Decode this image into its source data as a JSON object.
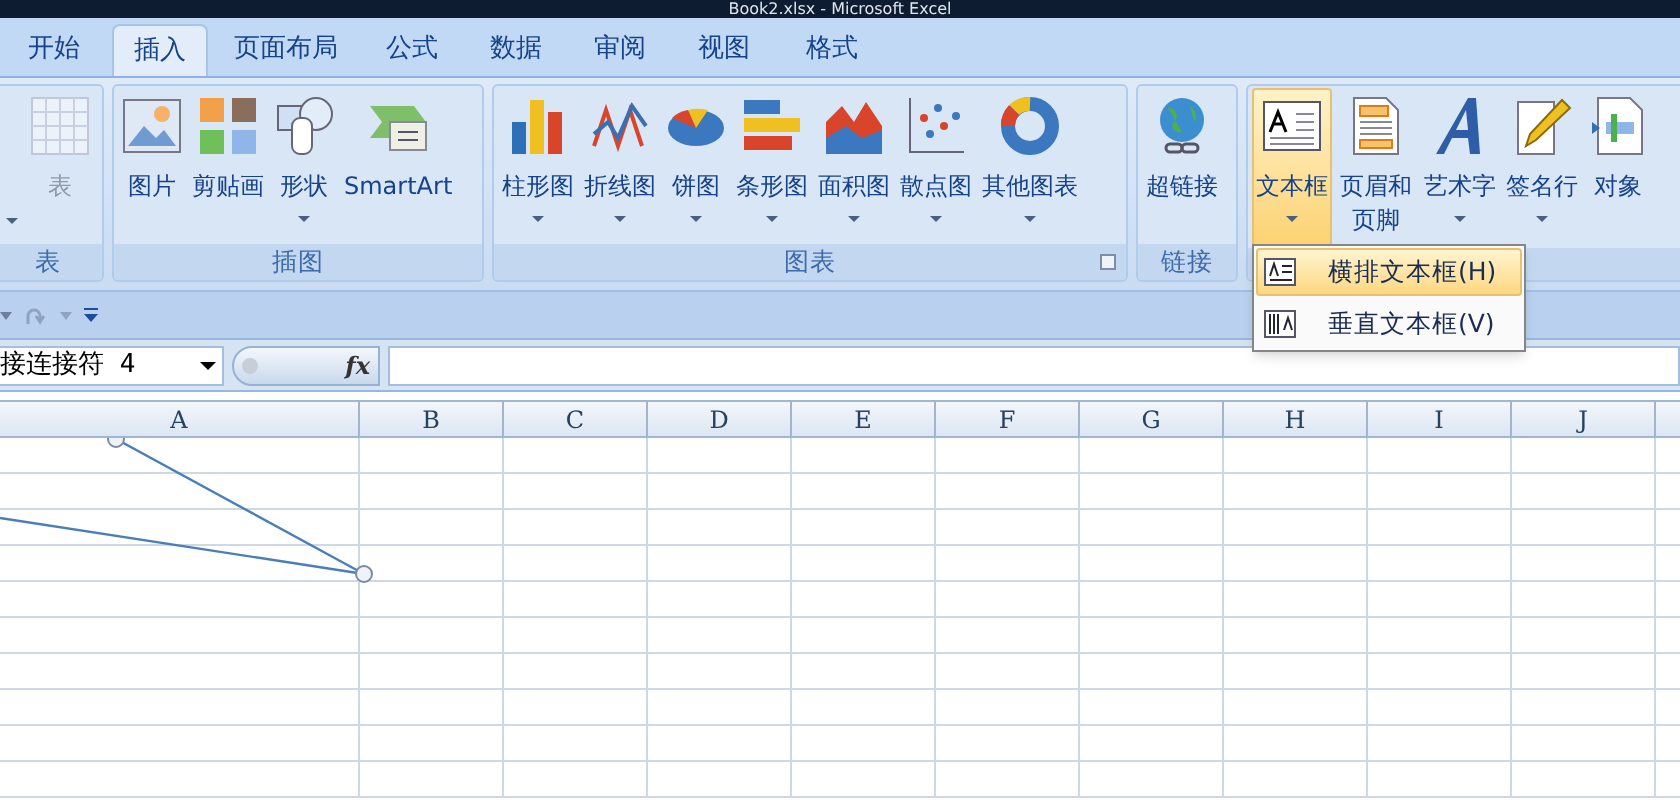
{
  "window": {
    "title": "Book2.xlsx - Microsoft Excel"
  },
  "tabs": [
    {
      "label": "开始",
      "selected": false
    },
    {
      "label": "插入",
      "selected": true
    },
    {
      "label": "页面布局",
      "selected": false
    },
    {
      "label": "公式",
      "selected": false
    },
    {
      "label": "数据",
      "selected": false
    },
    {
      "label": "审阅",
      "selected": false
    },
    {
      "label": "视图",
      "selected": false
    },
    {
      "label": "格式",
      "selected": false
    }
  ],
  "ribbon": {
    "groups": [
      {
        "label": "表",
        "launcher": false,
        "buttons": [
          {
            "dropdown": true
          },
          {
            "label": "表",
            "dropdown": false,
            "disabled": true
          }
        ]
      },
      {
        "label": "插图",
        "launcher": false,
        "buttons": [
          {
            "label": "图片",
            "dropdown": false
          },
          {
            "label": "剪贴画",
            "dropdown": false
          },
          {
            "label": "形状",
            "dropdown": true
          },
          {
            "label": "SmartArt",
            "dropdown": false
          }
        ]
      },
      {
        "label": "图表",
        "launcher": true,
        "buttons": [
          {
            "label": "柱形图",
            "dropdown": true
          },
          {
            "label": "折线图",
            "dropdown": true
          },
          {
            "label": "饼图",
            "dropdown": true
          },
          {
            "label": "条形图",
            "dropdown": true
          },
          {
            "label": "面积图",
            "dropdown": true
          },
          {
            "label": "散点图",
            "dropdown": true
          },
          {
            "label": "其他图表",
            "dropdown": true
          }
        ]
      },
      {
        "label": "链接",
        "launcher": false,
        "buttons": [
          {
            "label": "超链接",
            "dropdown": false
          }
        ]
      },
      {
        "buttons": [
          {
            "label": "文本框",
            "dropdown": true,
            "selected": true
          },
          {
            "label": "页眉和页脚",
            "selected": false
          },
          {
            "label": "艺术字",
            "dropdown": true,
            "selected": false
          },
          {
            "label": "签名行",
            "dropdown": true,
            "selected": false
          },
          {
            "label": "对象",
            "dropdown": false,
            "selected": false
          }
        ]
      }
    ]
  },
  "menu": {
    "items": [
      {
        "label": "横排文本框(H)",
        "selected": true
      },
      {
        "label": "垂直文本框(V)",
        "selected": false
      }
    ]
  },
  "name_box": {
    "value": "接连接符 4"
  },
  "formula_bar": {
    "fx": "fx"
  },
  "sheet": {
    "columns": [
      "A",
      "B",
      "C",
      "D",
      "E",
      "F",
      "G",
      "H",
      "I",
      "J"
    ]
  }
}
